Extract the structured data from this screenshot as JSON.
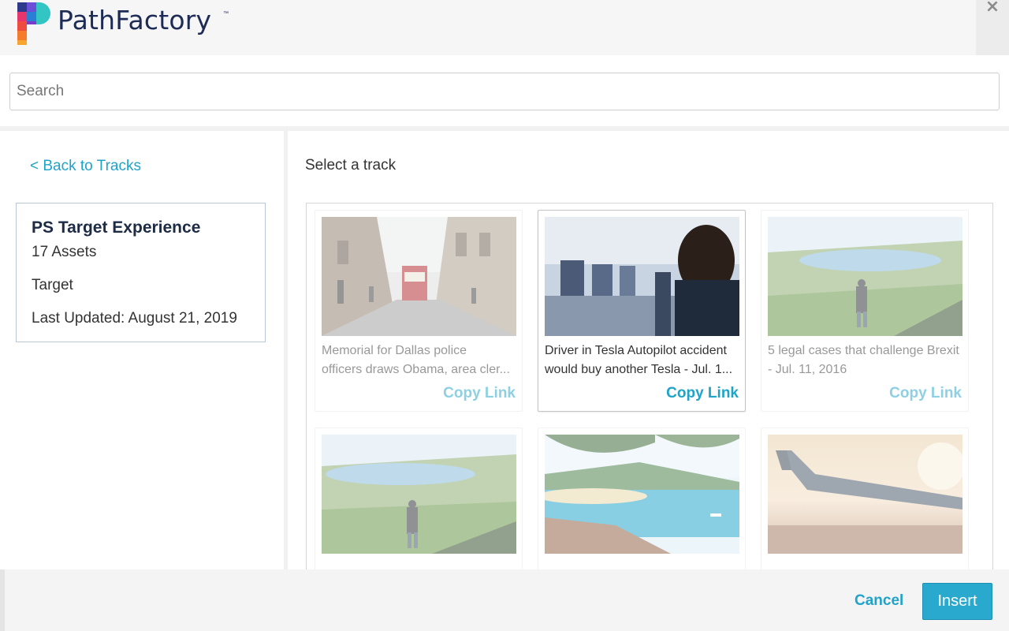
{
  "header": {
    "brand": "PathFactory",
    "trademark": "™",
    "close_label": "×"
  },
  "search": {
    "placeholder": "Search",
    "value": ""
  },
  "sidebar": {
    "back_link": "< Back to Tracks",
    "track": {
      "name": "PS Target Experience",
      "assets": "17 Assets",
      "tag": "Target",
      "last_updated": "Last Updated: August 21, 2019"
    }
  },
  "main": {
    "title": "Select a track",
    "assets": [
      {
        "title_line1": "Memorial for Dallas police",
        "title_line2": "officers draws Obama, area cler...",
        "copy_label": "Copy Link",
        "thumb": "street-tram-image"
      },
      {
        "title_line1": "Driver in Tesla Autopilot accident",
        "title_line2": "would buy another Tesla - Jul. 1...",
        "copy_label": "Copy Link",
        "thumb": "airplane-cabin-image"
      },
      {
        "title_line1": "5 legal cases that challenge Brexit",
        "title_line2": "- Jul. 11, 2016",
        "copy_label": "Copy Link",
        "thumb": "hiker-valley-image"
      },
      {
        "title_line1": "",
        "title_line2": "",
        "copy_label": "",
        "thumb": "hiker-valley-image"
      },
      {
        "title_line1": "",
        "title_line2": "",
        "copy_label": "",
        "thumb": "tropical-beach-image"
      },
      {
        "title_line1": "",
        "title_line2": "",
        "copy_label": "",
        "thumb": "airplane-wing-image"
      }
    ]
  },
  "footer": {
    "cancel_label": "Cancel",
    "insert_label": "Insert"
  },
  "colors": {
    "accent": "#1fa3c9",
    "brand_navy": "#1d2b55",
    "insert_bg": "#2aa9cf"
  }
}
